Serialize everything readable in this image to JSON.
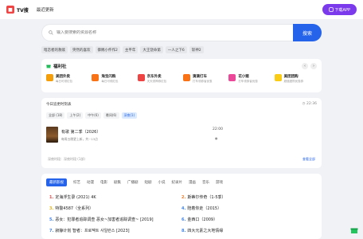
{
  "header": {
    "logo_mark": "■",
    "logo_text": "TV搜",
    "nav_recent": "最近更新",
    "download_label": "下载APP"
  },
  "search": {
    "placeholder": "输入要搜索的资源名称",
    "button_label": "搜索"
  },
  "hot_tags": [
    "暗恋者的救赎",
    "突然的喜欢",
    "御赐小仵作2",
    "主平年",
    "大王饶命第",
    "一人之下6",
    "斩神2"
  ],
  "perks": {
    "title": "福利社",
    "items": [
      {
        "title": "美团外卖",
        "sub": "每日可领红包",
        "color": "#f59e0b"
      },
      {
        "title": "淘宝闪购",
        "sub": "每日可领红包",
        "color": "#f97316"
      },
      {
        "title": "京东外卖",
        "sub": "天天领神券红包",
        "color": "#ef4444"
      },
      {
        "title": "滴滴打车",
        "sub": "打车领券省优惠",
        "color": "#f97316"
      },
      {
        "title": "花小猪",
        "sub": "打车领券省优惠",
        "color": "#ec4899"
      },
      {
        "title": "美团团购",
        "sub": "超值团购优惠券",
        "color": "#facc15"
      }
    ]
  },
  "schedule": {
    "title": "今日追更时刻表",
    "clock": "22:36",
    "days": [
      "全部 (18)",
      "上午(2)",
      "中午(6)",
      "晚间(6)",
      "深夜(1)"
    ],
    "active_day": 4,
    "show_title": "有歌 第二季（2026）",
    "show_time": "每周五晚更上新，共~13点",
    "time_label": "22:00",
    "time_dot": "●",
    "footer_left": "深夜时段：深夜时段 (1部)",
    "footer_more": "查看全部"
  },
  "rankings": {
    "tabs": [
      "最新影视",
      "综艺",
      "动漫",
      "电影",
      "剧集",
      "广播剧",
      "短剧",
      "小说",
      "纪录片",
      "漫画",
      "音乐",
      "游戏"
    ],
    "active_tab": 0,
    "items": [
      {
        "num": "1.",
        "title": "定海浮生录 (2021) 4K"
      },
      {
        "num": "2.",
        "title": "斯蒂尔传奇（1-5季）"
      },
      {
        "num": "3.",
        "title": "特警4587（全系列）"
      },
      {
        "num": "4.",
        "title": "陪着你走（2015）"
      },
      {
        "num": "5.",
        "title": "恶女：犯罪者追踪调查 恶女~加害者追踪调查~ [2019]"
      },
      {
        "num": "6.",
        "title": "金西口（2009）"
      },
      {
        "num": "7.",
        "title": "寂静计划 智者：프로젝트 사일런스 [2023]"
      },
      {
        "num": "8.",
        "title": "四大元素之大地情缘"
      }
    ]
  }
}
